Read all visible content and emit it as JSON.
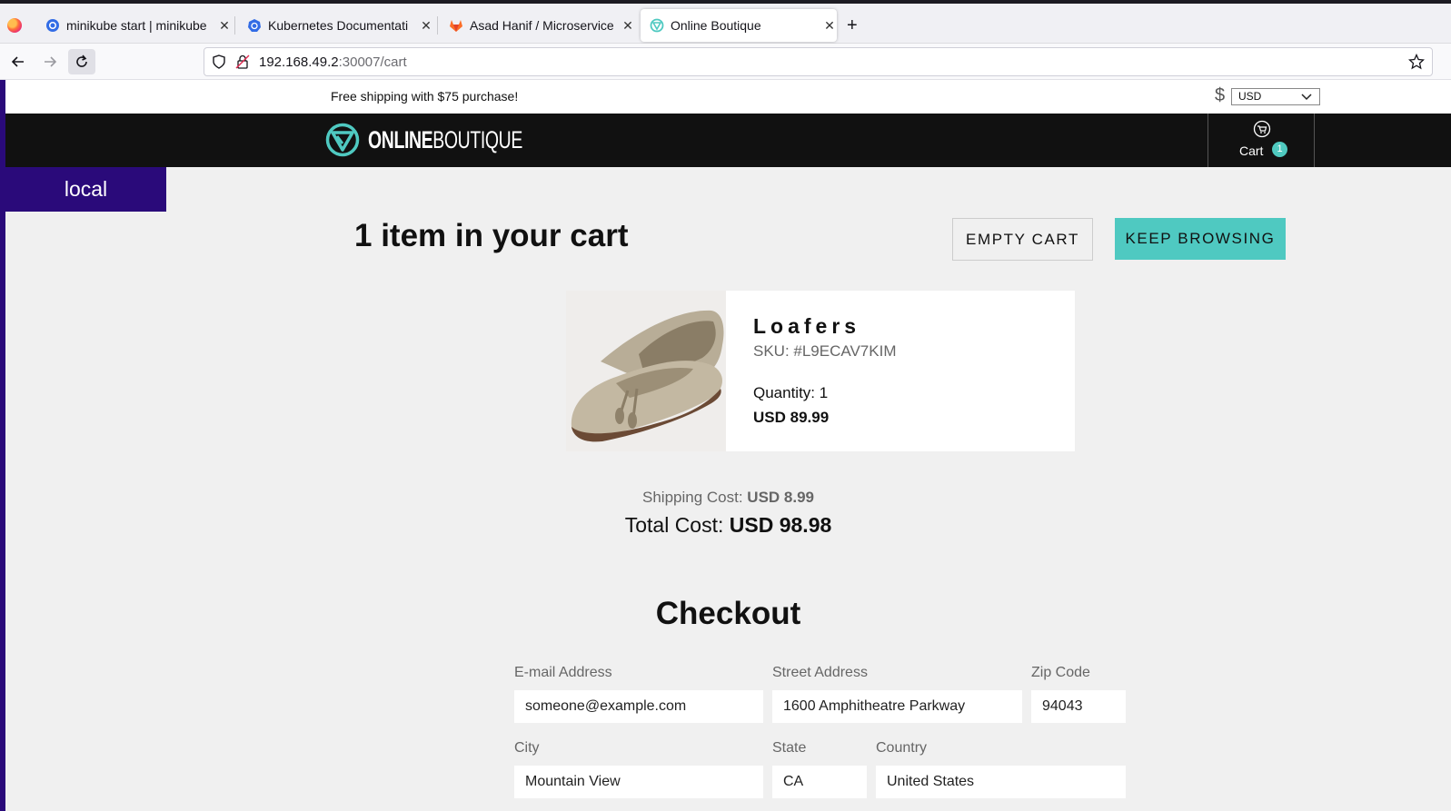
{
  "browser": {
    "tabs": [
      {
        "title": "minikube start | minikube",
        "active": false
      },
      {
        "title": "Kubernetes Documentati",
        "active": false
      },
      {
        "title": "Asad Hanif / Microservice",
        "active": false
      },
      {
        "title": "Online Boutique",
        "active": true
      }
    ],
    "url_host": "192.168.49.2",
    "url_path": ":30007/cart"
  },
  "promo": {
    "text": "Free shipping with $75 purchase!",
    "currency_symbol": "$",
    "currency_selected": "USD"
  },
  "header": {
    "logo_bold": "ONLINE",
    "logo_light": "BOUTIQUE",
    "cart_label": "Cart",
    "cart_count": "1"
  },
  "env_badge": "local",
  "cart": {
    "title": "1 item in your cart",
    "empty_button": "EMPTY CART",
    "keep_browsing_button": "KEEP BROWSING",
    "items": [
      {
        "name": "Loafers",
        "sku": "SKU: #L9ECAV7KIM",
        "quantity": "Quantity: 1",
        "price": "USD 89.99"
      }
    ],
    "shipping_label": "Shipping Cost: ",
    "shipping_value": "USD 8.99",
    "total_label": "Total Cost: ",
    "total_value": "USD 98.98"
  },
  "checkout": {
    "title": "Checkout",
    "email_label": "E-mail Address",
    "email_value": "someone@example.com",
    "street_label": "Street Address",
    "street_value": "1600 Amphitheatre Parkway",
    "zip_label": "Zip Code",
    "zip_value": "94043",
    "city_label": "City",
    "city_value": "Mountain View",
    "state_label": "State",
    "state_value": "CA",
    "country_label": "Country",
    "country_value": "United States"
  },
  "colors": {
    "accent": "#4fc9c1",
    "env_badge": "#2a0a7a",
    "header_bg": "#111111"
  }
}
